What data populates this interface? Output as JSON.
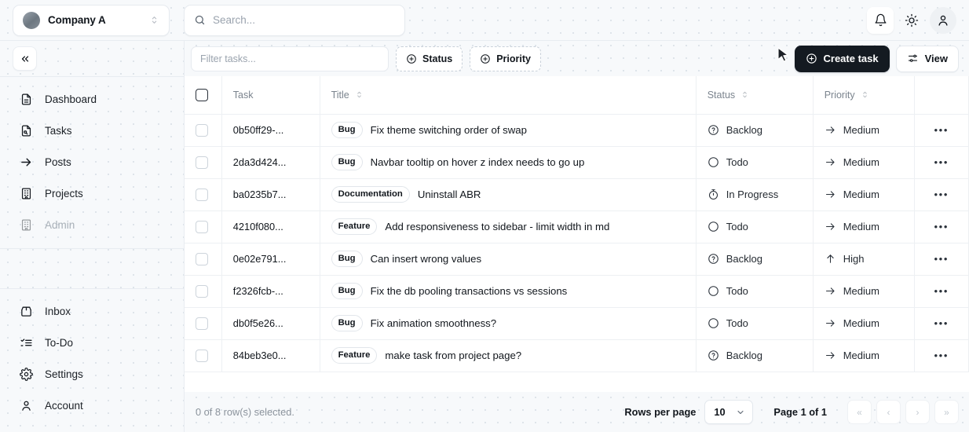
{
  "topbar": {
    "company": {
      "name": "Company A",
      "avatar_icon": "company-avatar",
      "chevron_icon": "chevron-up-down-icon"
    },
    "search": {
      "placeholder": "Search...",
      "icon": "search-icon"
    },
    "notifications_icon": "bell-icon",
    "theme_icon": "sun-icon",
    "account_icon": "user-icon"
  },
  "sidebar": {
    "collapse_icon": "chevrons-left-icon",
    "primary_items": [
      {
        "label": "Dashboard",
        "icon": "file-text-icon",
        "disabled": false
      },
      {
        "label": "Tasks",
        "icon": "file-code-icon",
        "disabled": false
      },
      {
        "label": "Posts",
        "icon": "arrow-right-icon",
        "disabled": false
      },
      {
        "label": "Projects",
        "icon": "building-icon",
        "disabled": false
      },
      {
        "label": "Admin",
        "icon": "building-icon",
        "disabled": true
      }
    ],
    "secondary_items": [
      {
        "label": "Inbox",
        "icon": "inbox-icon",
        "disabled": false
      },
      {
        "label": "To-Do",
        "icon": "list-checks-icon",
        "disabled": false
      },
      {
        "label": "Settings",
        "icon": "gear-icon",
        "disabled": false
      },
      {
        "label": "Account",
        "icon": "user-icon",
        "disabled": false
      }
    ]
  },
  "toolbar": {
    "filter_placeholder": "Filter tasks...",
    "status_filter_label": "Status",
    "priority_filter_label": "Priority",
    "filter_icon": "plus-circle-icon",
    "create_label": "Create task",
    "create_icon": "plus-circle-icon",
    "view_label": "View",
    "view_icon": "sliders-icon"
  },
  "table": {
    "columns": [
      {
        "key": "check",
        "label": "",
        "sortable": false
      },
      {
        "key": "task",
        "label": "Task",
        "sortable": false
      },
      {
        "key": "title",
        "label": "Title",
        "sortable": true
      },
      {
        "key": "status",
        "label": "Status",
        "sortable": true
      },
      {
        "key": "priority",
        "label": "Priority",
        "sortable": true
      },
      {
        "key": "actions",
        "label": "",
        "sortable": false
      }
    ],
    "sort_icon": "chevron-up-down-icon",
    "row_menu_icon": "ellipsis-icon",
    "rows": [
      {
        "task": "0b50ff29-...",
        "badge": "Bug",
        "title": "Fix theme switching order of swap",
        "status": "Backlog",
        "status_icon": "question-circle-icon",
        "priority": "Medium",
        "priority_icon": "arrow-right-icon"
      },
      {
        "task": "2da3d424...",
        "badge": "Bug",
        "title": "Navbar tooltip on hover z index needs to go up",
        "status": "Todo",
        "status_icon": "circle-icon",
        "priority": "Medium",
        "priority_icon": "arrow-right-icon"
      },
      {
        "task": "ba0235b7...",
        "badge": "Documentation",
        "title": "Uninstall ABR",
        "status": "In Progress",
        "status_icon": "timer-icon",
        "priority": "Medium",
        "priority_icon": "arrow-right-icon"
      },
      {
        "task": "4210f080...",
        "badge": "Feature",
        "title": "Add responsiveness to sidebar - limit width in md",
        "status": "Todo",
        "status_icon": "circle-icon",
        "priority": "Medium",
        "priority_icon": "arrow-right-icon"
      },
      {
        "task": "0e02e791...",
        "badge": "Bug",
        "title": "Can insert wrong values",
        "status": "Backlog",
        "status_icon": "question-circle-icon",
        "priority": "High",
        "priority_icon": "arrow-up-icon"
      },
      {
        "task": "f2326fcb-...",
        "badge": "Bug",
        "title": "Fix the db pooling transactions vs sessions",
        "status": "Todo",
        "status_icon": "circle-icon",
        "priority": "Medium",
        "priority_icon": "arrow-right-icon"
      },
      {
        "task": "db0f5e26...",
        "badge": "Bug",
        "title": "Fix animation smoothness?",
        "status": "Todo",
        "status_icon": "circle-icon",
        "priority": "Medium",
        "priority_icon": "arrow-right-icon"
      },
      {
        "task": "84beb3e0...",
        "badge": "Feature",
        "title": "make task from project page?",
        "status": "Backlog",
        "status_icon": "question-circle-icon",
        "priority": "Medium",
        "priority_icon": "arrow-right-icon"
      }
    ]
  },
  "footer": {
    "selection_text": "0 of 8 row(s) selected.",
    "rows_per_page_label": "Rows per page",
    "rows_per_page_value": "10",
    "page_label": "Page 1 of 1",
    "pager": [
      {
        "name": "first-page",
        "glyph": "«"
      },
      {
        "name": "prev-page",
        "glyph": "‹"
      },
      {
        "name": "next-page",
        "glyph": "›"
      },
      {
        "name": "last-page",
        "glyph": "»"
      }
    ]
  },
  "colors": {
    "accent": "#141a21",
    "page_bg": "#f7f9fb",
    "border": "#e8ecf1",
    "muted_text": "#7b848e"
  }
}
